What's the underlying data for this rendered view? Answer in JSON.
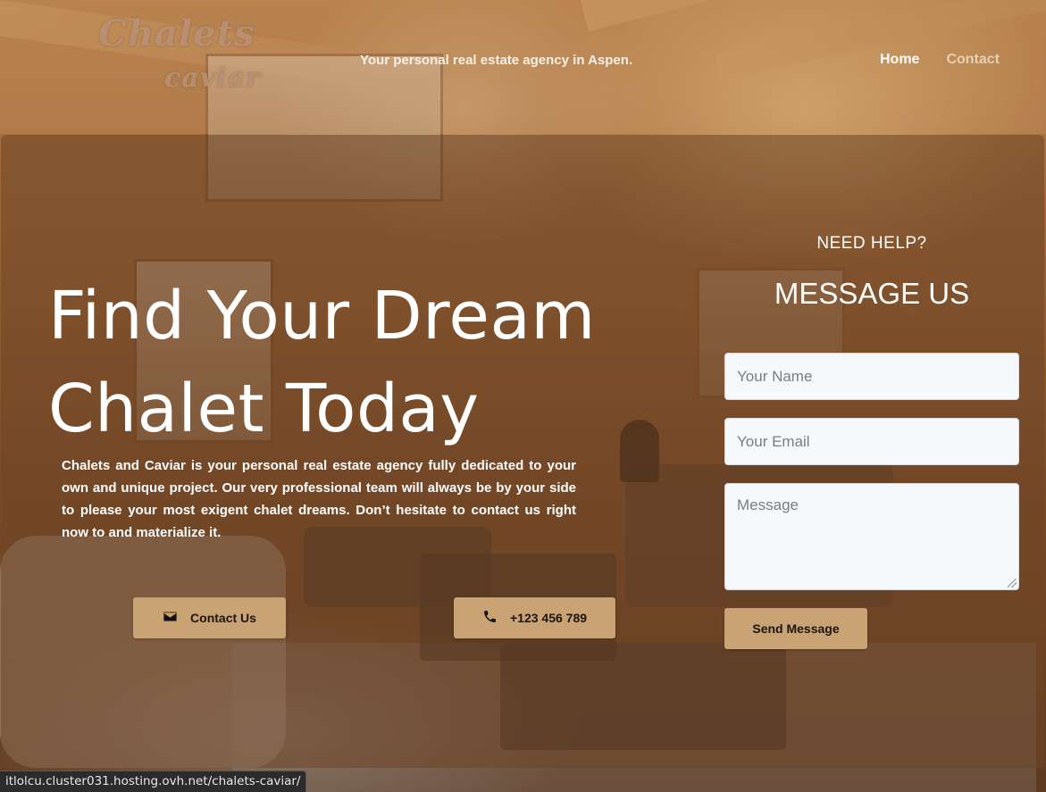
{
  "header": {
    "logo_line1": "Chalets",
    "logo_line2": "caviar",
    "tagline": "Your personal real estate agency in Aspen."
  },
  "nav": {
    "items": [
      {
        "label": "Home",
        "active": true
      },
      {
        "label": "Contact",
        "active": false
      }
    ]
  },
  "hero": {
    "title_line1": "Find Your Dream",
    "title_line2": "Chalet Today",
    "description": "Chalets and Caviar is your personal real estate agency fully dedicated to your own and unique project. Our very professional team will always be by your side to please your most exigent chalet dreams. Don’t hesitate to contact us right now to  and materialize it.",
    "contact_button": {
      "label": "Contact Us",
      "icon": "envelope-icon"
    },
    "phone_button": {
      "label": "+123 456 789",
      "icon": "phone-icon"
    }
  },
  "form": {
    "help_text": "NEED HELP?",
    "title": "MESSAGE US",
    "name_placeholder": "Your Name",
    "email_placeholder": "Your Email",
    "message_placeholder": "Message",
    "submit_label": "Send Message"
  },
  "status_bar": {
    "url": "itlolcu.cluster031.hosting.ovh.net/chalets-caviar/"
  },
  "colors": {
    "accent": "#c9a373",
    "overlay": "#6e4628",
    "text_light": "#ffffff",
    "nav_inactive": "#e6d0b6"
  }
}
